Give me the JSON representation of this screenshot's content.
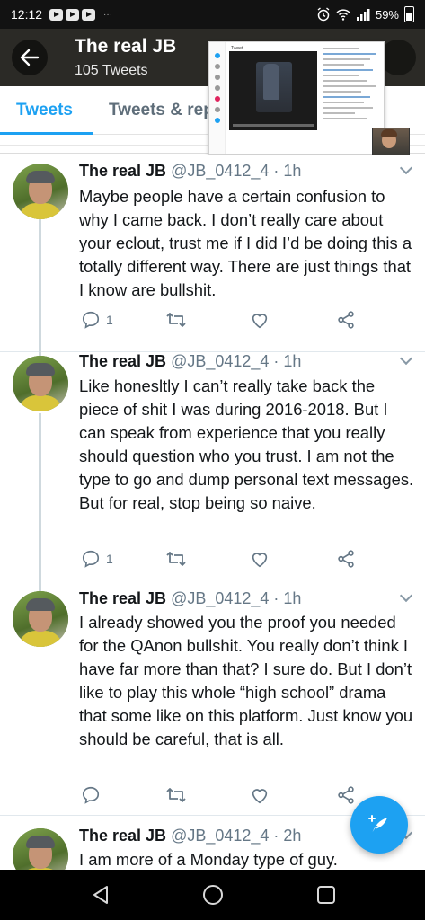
{
  "status_bar": {
    "time": "12:12",
    "battery": "59%",
    "icons": [
      "youtube-icon",
      "youtube-icon",
      "youtube-icon",
      "more-dots-icon",
      "alarm-icon",
      "wifi-icon",
      "signal-icon",
      "battery-icon"
    ]
  },
  "header": {
    "title": "The real JB",
    "tweet_count": "105 Tweets"
  },
  "tabs": [
    {
      "label": "Tweets",
      "active": true
    },
    {
      "label": "Tweets & rep",
      "active": false
    }
  ],
  "accent_color": "#1da1f2",
  "tweets": [
    {
      "name": "The real JB",
      "meta": "@JB_0412_4 · 1h",
      "text": "Maybe people have a certain confusion to why I came back. I don’t really care about your eclout, trust me if I did I’d be doing this a totally different way. There are just things that I know are bullshit.",
      "reply_count": "1",
      "retweet_count": "",
      "like_count": ""
    },
    {
      "name": "The real JB",
      "meta": "@JB_0412_4 · 1h",
      "text": "Like honesltly I can’t really take back the piece of shit I was during 2016-2018. But I can speak from experience that you really should question who you trust. I am not the type to go and dump personal text messages. But for real, stop being so naive.",
      "reply_count": "1",
      "retweet_count": "",
      "like_count": ""
    },
    {
      "name": "The real JB",
      "meta": "@JB_0412_4 · 1h",
      "text": "I already showed you the proof you needed for the QAnon bullshit. You really don’t think I have far more than that? I sure do. But I don’t like to play this whole “high school” drama that some like on this platform. Just know you should be careful, that is all.",
      "reply_count": "",
      "retweet_count": "",
      "like_count": ""
    },
    {
      "name": "The real JB",
      "meta": "@JB_0412_4 · 2h",
      "text": "I am more of a Monday type of guy.",
      "reply_count": "",
      "retweet_count": "",
      "like_count": ""
    }
  ],
  "overlay": {
    "label": "Tweet"
  }
}
